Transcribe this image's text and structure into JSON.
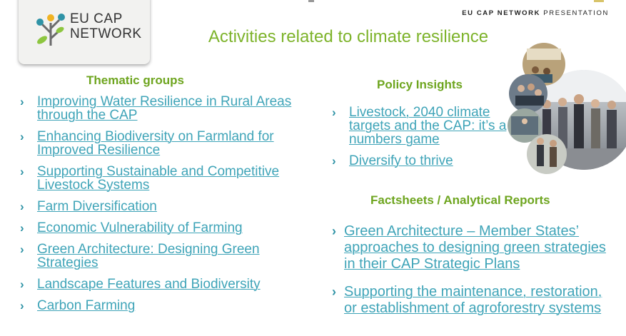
{
  "logo": {
    "line1": "EU CAP",
    "line2": "NETWORK"
  },
  "header_tag": {
    "bold": "EU CAP NETWORK",
    "rest": "PRESENTATION"
  },
  "title": "Activities related to climate resilience",
  "thematic": {
    "heading": "Thematic groups",
    "items": [
      "Improving Water Resilience in Rural Areas through the CAP",
      "Enhancing Biodiversity on Farmland for Improved Resilience",
      "Supporting Sustainable and Competitive Livestock Systems",
      "Farm Diversification",
      "Economic Vulnerability of Farming",
      "Green Architecture: Designing Green Strategies",
      "Landscape Features and Biodiversity",
      "Carbon Farming"
    ]
  },
  "policy": {
    "heading": "Policy Insights",
    "items": [
      "Livestock, 2040 climate targets and the CAP: it’s a numbers game",
      "Diversify to thrive"
    ]
  },
  "factsheets": {
    "heading": "Factsheets / Analytical Reports",
    "items": [
      "Green Architecture – Member States’ approaches to designing green strategies in their CAP Strategic Plans",
      "Supporting the maintenance, restoration, or establishment of agroforestry systems"
    ]
  },
  "colors": {
    "title_green": "#7db32a",
    "heading_green": "#6ea51f",
    "link_teal": "#3fa4b8",
    "chevron": "#2f93a6"
  }
}
